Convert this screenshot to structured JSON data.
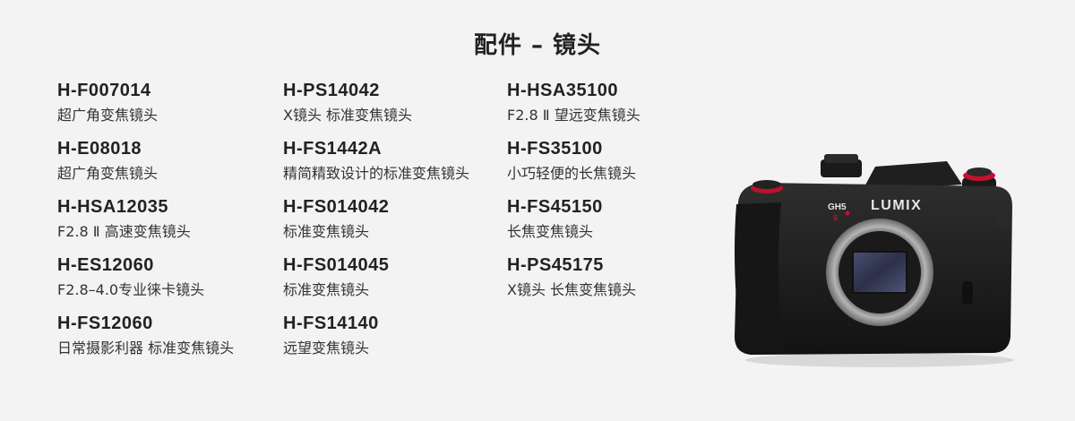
{
  "title": "配件 – 镜头",
  "columns": [
    {
      "items": [
        {
          "model": "H-F007014",
          "desc": "超广角变焦镜头"
        },
        {
          "model": "H-E08018",
          "desc": "超广角变焦镜头"
        },
        {
          "model": "H-HSA12035",
          "desc": "F2.8 Ⅱ 高速变焦镜头"
        },
        {
          "model": "H-ES12060",
          "desc": "F2.8–4.0专业徕卡镜头"
        },
        {
          "model": "H-FS12060",
          "desc": "日常摄影利器 标准变焦镜头"
        }
      ]
    },
    {
      "items": [
        {
          "model": "H-PS14042",
          "desc": "X镜头 标准变焦镜头"
        },
        {
          "model": "H-FS1442A",
          "desc": "精简精致设计的标准变焦镜头"
        },
        {
          "model": "H-FS014042",
          "desc": "标准变焦镜头"
        },
        {
          "model": "H-FS014045",
          "desc": "标准变焦镜头"
        },
        {
          "model": "H-FS14140",
          "desc": "远望变焦镜头"
        }
      ]
    },
    {
      "items": [
        {
          "model": "H-HSA35100",
          "desc": "F2.8 Ⅱ 望远变焦镜头"
        },
        {
          "model": "H-FS35100",
          "desc": "小巧轻便的长焦镜头"
        },
        {
          "model": "H-FS45150",
          "desc": "长焦变焦镜头"
        },
        {
          "model": "H-PS45175",
          "desc": "X镜头 长焦变焦镜头"
        }
      ]
    }
  ],
  "camera": {
    "brand_text": "LUMIX",
    "model_badge": "GH5",
    "model_sub": "S",
    "colors": {
      "body": "#1c1c1c",
      "accent_red": "#c8102e",
      "sensor": "#3b3f5a",
      "mount": "#9a9a9a"
    }
  }
}
